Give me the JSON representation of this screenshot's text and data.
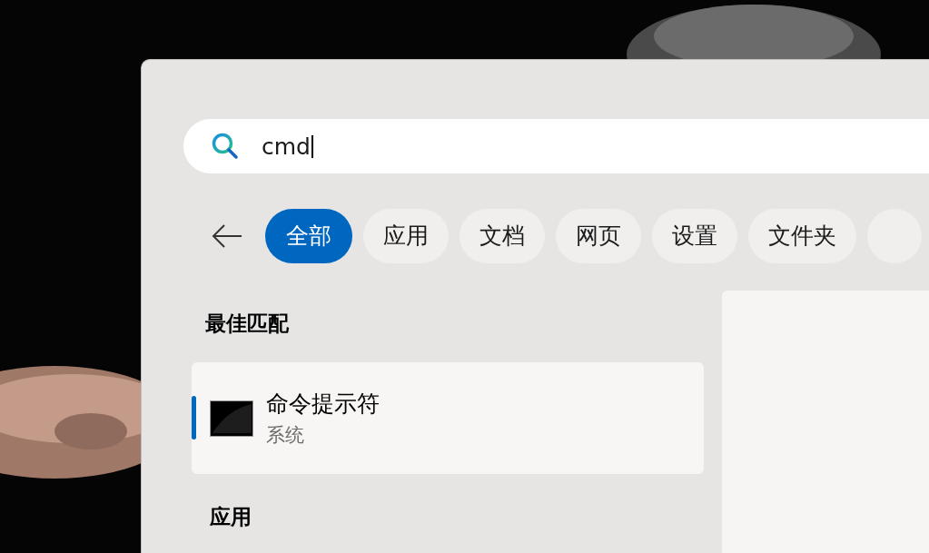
{
  "search": {
    "value": "cmd"
  },
  "filters": [
    {
      "label": "全部",
      "selected": true
    },
    {
      "label": "应用",
      "selected": false
    },
    {
      "label": "文档",
      "selected": false
    },
    {
      "label": "网页",
      "selected": false
    },
    {
      "label": "设置",
      "selected": false
    },
    {
      "label": "文件夹",
      "selected": false
    }
  ],
  "best_match": {
    "heading": "最佳匹配",
    "result": {
      "title": "命令提示符",
      "subtitle": "系统",
      "selected": true
    }
  },
  "apps": {
    "heading": "应用"
  }
}
